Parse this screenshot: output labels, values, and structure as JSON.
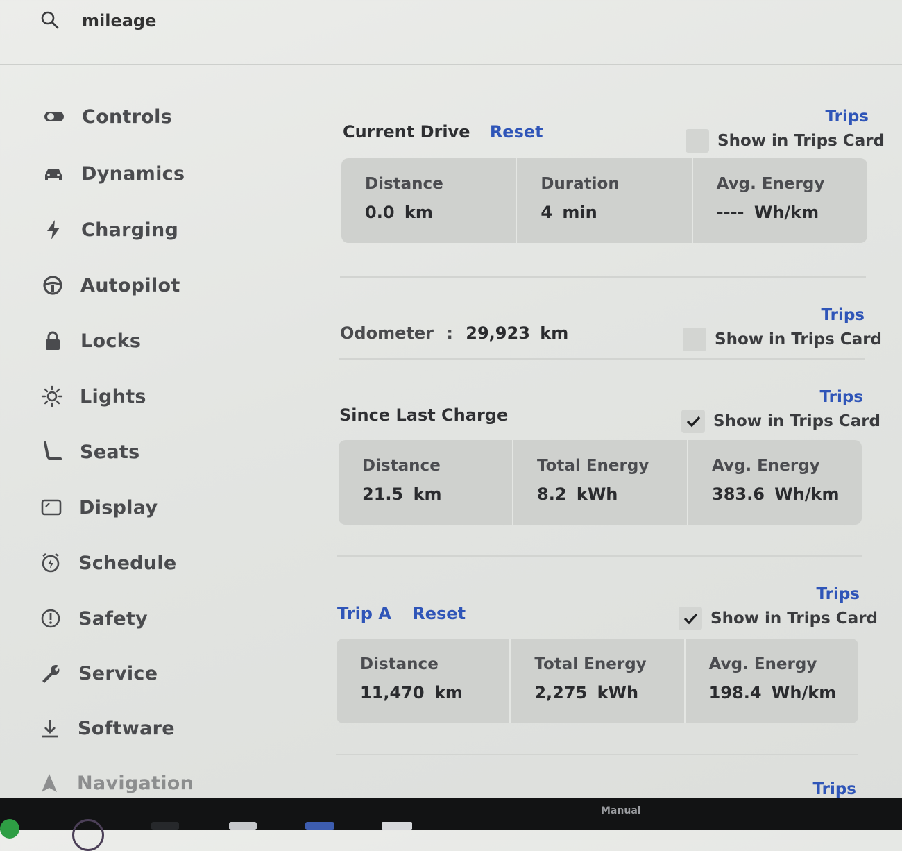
{
  "search": {
    "query": "mileage"
  },
  "sidebar": {
    "items": [
      {
        "label": "Controls",
        "icon": "toggle-icon"
      },
      {
        "label": "Dynamics",
        "icon": "car-icon"
      },
      {
        "label": "Charging",
        "icon": "lightning-icon"
      },
      {
        "label": "Autopilot",
        "icon": "steering-wheel-icon"
      },
      {
        "label": "Locks",
        "icon": "lock-icon"
      },
      {
        "label": "Lights",
        "icon": "sun-icon"
      },
      {
        "label": "Seats",
        "icon": "seat-icon"
      },
      {
        "label": "Display",
        "icon": "display-icon"
      },
      {
        "label": "Schedule",
        "icon": "schedule-icon"
      },
      {
        "label": "Safety",
        "icon": "alert-icon"
      },
      {
        "label": "Service",
        "icon": "wrench-icon"
      },
      {
        "label": "Software",
        "icon": "download-icon"
      },
      {
        "label": "Navigation",
        "icon": "navigation-icon"
      }
    ]
  },
  "sections": {
    "current_drive": {
      "title": "Current Drive",
      "reset_label": "Reset",
      "trips_label": "Trips",
      "show_label": "Show in Trips Card",
      "checked": false,
      "stats": [
        {
          "label": "Distance",
          "value": "0.0 km"
        },
        {
          "label": "Duration",
          "value": "4 min"
        },
        {
          "label": "Avg. Energy",
          "value": "---- Wh/km"
        }
      ]
    },
    "odometer": {
      "label": "Odometer",
      "separator": ":",
      "value": "29,923 km",
      "trips_label": "Trips",
      "show_label": "Show in Trips Card",
      "checked": false
    },
    "since_last_charge": {
      "title": "Since Last Charge",
      "trips_label": "Trips",
      "show_label": "Show in Trips Card",
      "checked": true,
      "stats": [
        {
          "label": "Distance",
          "value": "21.5 km"
        },
        {
          "label": "Total Energy",
          "value": "8.2 kWh"
        },
        {
          "label": "Avg. Energy",
          "value": "383.6 Wh/km"
        }
      ]
    },
    "trip_a": {
      "title": "Trip A",
      "reset_label": "Reset",
      "trips_label": "Trips",
      "show_label": "Show in Trips Card",
      "checked": true,
      "stats": [
        {
          "label": "Distance",
          "value": "11,470 km"
        },
        {
          "label": "Total Energy",
          "value": "2,275 kWh"
        },
        {
          "label": "Avg. Energy",
          "value": "198.4 Wh/km"
        }
      ]
    },
    "next": {
      "trips_label": "Trips"
    }
  },
  "taskbar": {
    "mode_label": "Manual"
  },
  "colors": {
    "accent": "#2f55b8",
    "card": "#cfd1ce",
    "background": "#e6e8e5",
    "taskbar": "#121314"
  }
}
